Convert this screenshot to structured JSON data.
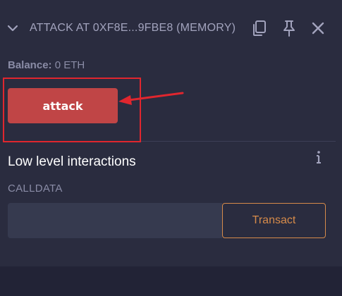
{
  "header": {
    "title": "ATTACK AT 0XF8E...9FBE8 (MEMORY)",
    "icons": [
      "chevron-down-icon",
      "copy-icon",
      "pin-icon",
      "close-icon"
    ]
  },
  "balance": {
    "label": "Balance:",
    "value": "0 ETH"
  },
  "function_button": {
    "label": "attack"
  },
  "low_level": {
    "title": "Low level interactions",
    "calldata_label": "CALLDATA",
    "calldata_value": "",
    "transact_label": "Transact"
  },
  "colors": {
    "panel_bg": "#2a2c3f",
    "attack_button": "#c04546",
    "transact_border": "#d68b4a",
    "annotation_red": "#e0262e"
  }
}
